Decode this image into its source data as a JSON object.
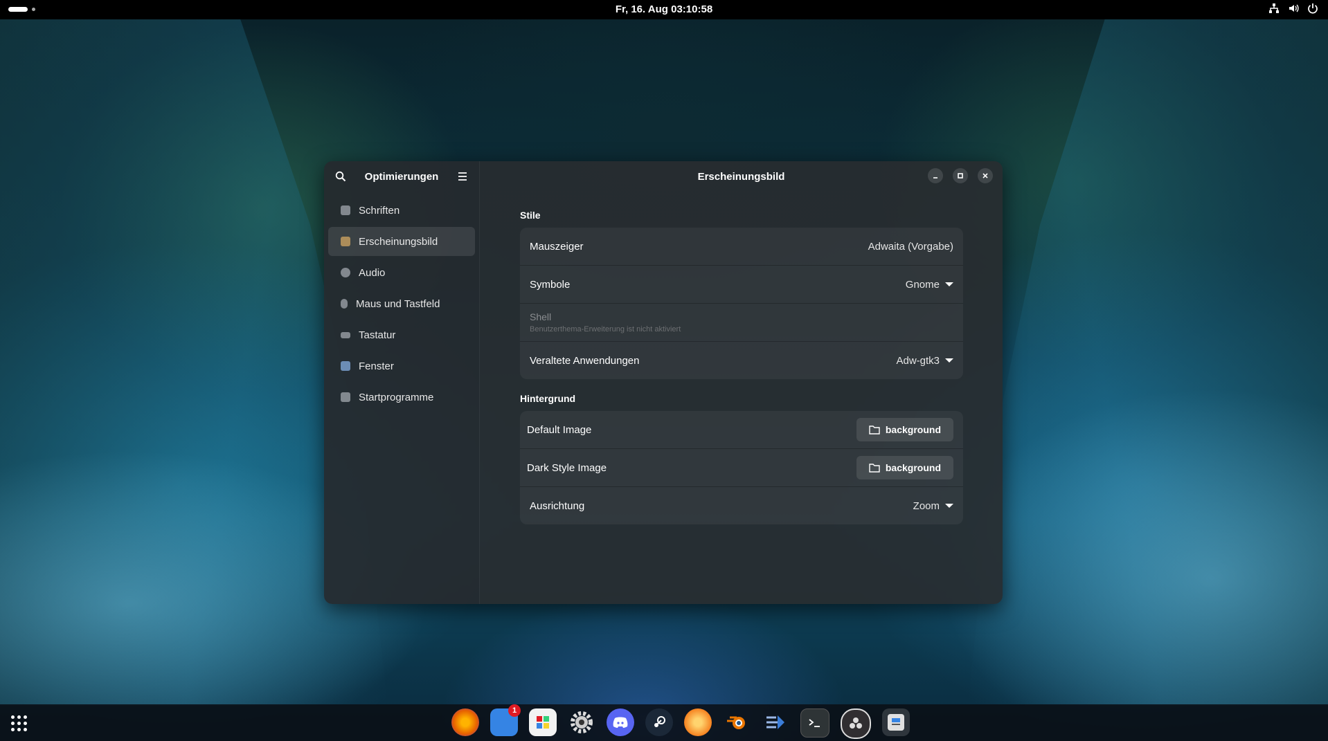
{
  "topbar": {
    "clock": "Fr, 16. Aug  03:10:58",
    "tray_icons": [
      "network-icon",
      "volume-icon",
      "power-icon"
    ]
  },
  "window": {
    "sidebar": {
      "title": "Optimierungen",
      "items": [
        {
          "label": "Schriften",
          "icon": "font-icon"
        },
        {
          "label": "Erscheinungsbild",
          "icon": "appearance-icon",
          "active": true
        },
        {
          "label": "Audio",
          "icon": "audio-icon"
        },
        {
          "label": "Maus und Tastfeld",
          "icon": "mouse-icon"
        },
        {
          "label": "Tastatur",
          "icon": "keyboard-icon"
        },
        {
          "label": "Fenster",
          "icon": "window-icon"
        },
        {
          "label": "Startprogramme",
          "icon": "startup-icon"
        }
      ]
    },
    "title": "Erscheinungsbild",
    "sections": {
      "stile": {
        "title": "Stile",
        "mauszeiger": {
          "label": "Mauszeiger",
          "value": "Adwaita (Vorgabe)"
        },
        "symbole": {
          "label": "Symbole",
          "value": "Gnome"
        },
        "shell": {
          "label": "Shell",
          "sub": "Benutzerthema-Erweiterung ist nicht aktiviert"
        },
        "veraltete": {
          "label": "Veraltete Anwendungen",
          "value": "Adw-gtk3"
        }
      },
      "hintergrund": {
        "title": "Hintergrund",
        "default_image": {
          "label": "Default Image",
          "button": "background"
        },
        "dark_image": {
          "label": "Dark Style Image",
          "button": "background"
        },
        "ausrichtung": {
          "label": "Ausrichtung",
          "value": "Zoom"
        }
      }
    }
  },
  "dock": {
    "apps": [
      {
        "name": "firefox",
        "color": "#e66000"
      },
      {
        "name": "notes",
        "color": "#3584e4",
        "badge": "1"
      },
      {
        "name": "software",
        "color": "#ffffff"
      },
      {
        "name": "settings",
        "color": "#c0c0c0"
      },
      {
        "name": "discord",
        "color": "#5865f2"
      },
      {
        "name": "steam",
        "color": "#1b2838"
      },
      {
        "name": "app-orange",
        "color": "#f58220"
      },
      {
        "name": "blender",
        "color": "#ea7600"
      },
      {
        "name": "app-blue",
        "color": "#3b7dd8"
      },
      {
        "name": "terminal",
        "color": "#2e3436"
      },
      {
        "name": "obs",
        "color": "#302e31"
      },
      {
        "name": "tweaks",
        "color": "#e0e0e0"
      }
    ]
  }
}
